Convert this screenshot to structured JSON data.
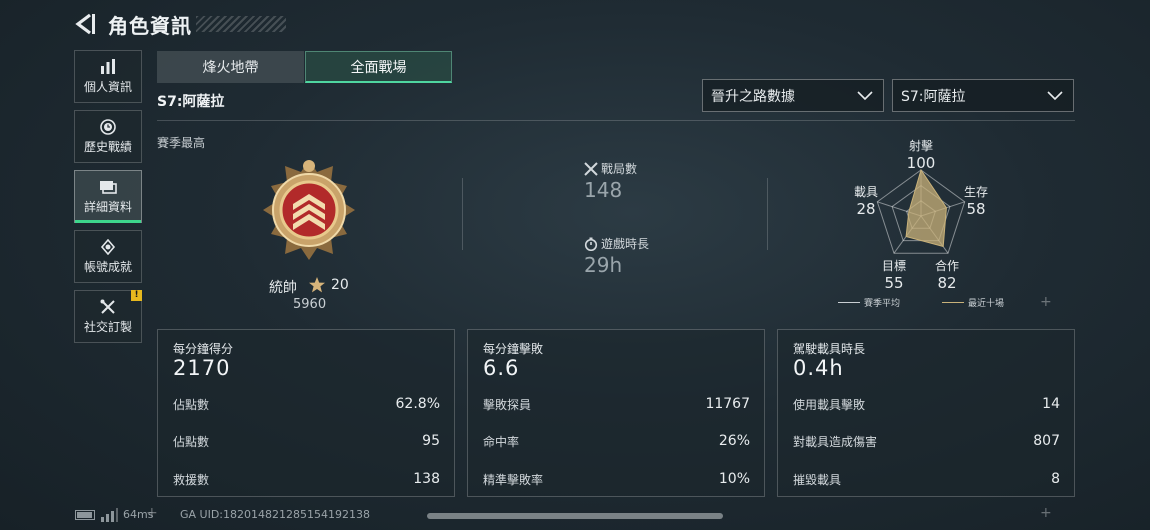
{
  "header": {
    "title": "角色資訊",
    "back_icon": "back-arrow-icon"
  },
  "sidebar": {
    "items": [
      {
        "label": "個人資訊",
        "icon": "bar-chart-icon",
        "active": false
      },
      {
        "label": "歷史戰績",
        "icon": "history-icon",
        "active": false
      },
      {
        "label": "詳細資料",
        "icon": "cards-icon",
        "active": true
      },
      {
        "label": "帳號成就",
        "icon": "achievement-icon",
        "active": false
      },
      {
        "label": "社交訂製",
        "icon": "tools-icon",
        "active": false,
        "badge": "!"
      }
    ]
  },
  "tabs": [
    {
      "label": "烽火地帶",
      "selected": false
    },
    {
      "label": "全面戰場",
      "selected": true
    }
  ],
  "season_label": "S7:阿薩拉",
  "filters": {
    "mode": {
      "value": "晉升之路數據"
    },
    "season": {
      "value": "S7:阿薩拉"
    }
  },
  "season_best": {
    "label": "賽季最高",
    "rank_name": "統帥",
    "stars": "20",
    "points": "5960"
  },
  "match_stats": {
    "matches": {
      "label": "戰局數",
      "value": "148",
      "icon": "crossed-swords-icon"
    },
    "playtime": {
      "label": "遊戲時長",
      "value": "29h",
      "icon": "stopwatch-icon"
    }
  },
  "radar": {
    "axes": [
      {
        "label": "射擊",
        "value": "100"
      },
      {
        "label": "生存",
        "value": "58"
      },
      {
        "label": "合作",
        "value": "82"
      },
      {
        "label": "目標",
        "value": "55"
      },
      {
        "label": "載具",
        "value": "28"
      }
    ],
    "legend": [
      {
        "label": "賽季平均",
        "color": "#c9cfd3"
      },
      {
        "label": "最近十場",
        "color": "#c9b27a"
      }
    ],
    "fill_color": "#c9b27a"
  },
  "cards": [
    {
      "head_label": "每分鐘得分",
      "head_value": "2170",
      "rows": [
        {
          "k": "佔點數",
          "v": "62.8%"
        },
        {
          "k": "佔點數",
          "v": "95"
        },
        {
          "k": "救援數",
          "v": "138"
        }
      ]
    },
    {
      "head_label": "每分鐘擊敗",
      "head_value": "6.6",
      "rows": [
        {
          "k": "擊敗探員",
          "v": "11767"
        },
        {
          "k": "命中率",
          "v": "26%"
        },
        {
          "k": "精準擊敗率",
          "v": "10%"
        }
      ]
    },
    {
      "head_label": "駕駛載具時長",
      "head_value": "0.4h",
      "rows": [
        {
          "k": "使用載具擊敗",
          "v": "14"
        },
        {
          "k": "對載具造成傷害",
          "v": "807"
        },
        {
          "k": "摧毀載具",
          "v": "8"
        }
      ]
    }
  ],
  "footer": {
    "ping": "64ms",
    "uid": "GA UID:182014821285154192138"
  },
  "colors": {
    "accent": "#3dd68c",
    "badge": "#e6b81e"
  }
}
